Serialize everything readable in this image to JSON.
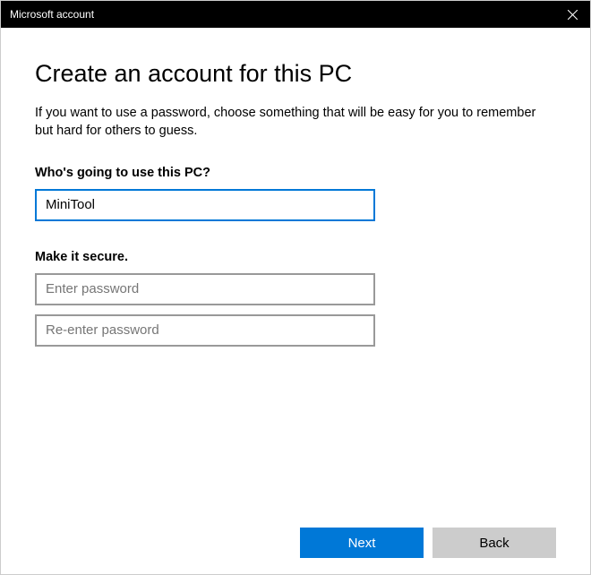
{
  "titlebar": {
    "title": "Microsoft account"
  },
  "main": {
    "heading": "Create an account for this PC",
    "subheading": "If you want to use a password, choose something that will be easy for you to remember but hard for others to guess.",
    "username_section_label": "Who's going to use this PC?",
    "username_value": "MiniTool",
    "security_section_label": "Make it secure.",
    "password_placeholder": "Enter password",
    "password_confirm_placeholder": "Re-enter password"
  },
  "footer": {
    "next_label": "Next",
    "back_label": "Back"
  }
}
